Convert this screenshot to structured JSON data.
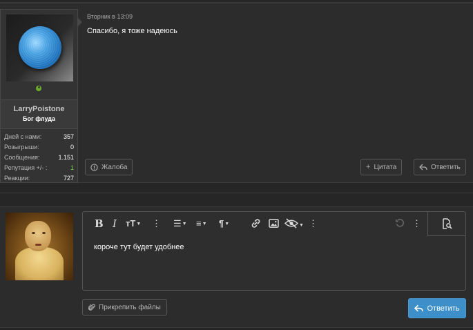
{
  "post": {
    "user": {
      "username": "LarryPoistone",
      "title": "Бог флуда",
      "stats": [
        {
          "label": "Дней с нами:",
          "value": "357"
        },
        {
          "label": "Розыгрыши:",
          "value": "0"
        },
        {
          "label": "Сообщения:",
          "value": "1.151"
        },
        {
          "label": "Репутация +/- :",
          "value": "1"
        },
        {
          "label": "Реакции:",
          "value": "727"
        }
      ]
    },
    "date": "Вторник в 13:09",
    "text": "Спасибо, я тоже надеюсь",
    "actions": {
      "report": "Жалоба",
      "quote": "Цитата",
      "reply": "Ответить"
    }
  },
  "reply_form": {
    "editor_text": "короче тут будет удобнее",
    "attach_label": "Прикрепить файлы",
    "submit_label": "Ответить"
  },
  "colors": {
    "background": "#262626",
    "panel": "#2c2c2c",
    "online": "#6fae2a",
    "reputation": "#7bd34a",
    "submit": "#3d8fc9"
  },
  "icons": [
    "bold-icon",
    "italic-icon",
    "text-size-icon",
    "more-icon",
    "list-icon",
    "align-icon",
    "paragraph-icon",
    "link-icon",
    "image-icon",
    "hide-icon",
    "undo-icon",
    "preview-icon",
    "paperclip-icon",
    "reply-arrow-icon",
    "plus-icon",
    "report-icon"
  ]
}
